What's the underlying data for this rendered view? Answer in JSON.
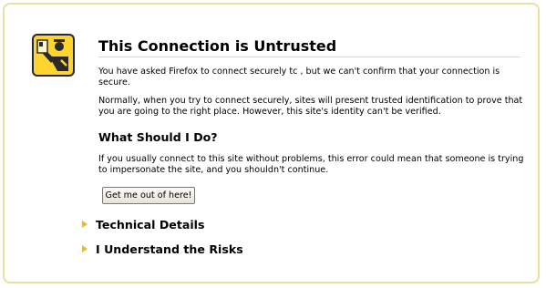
{
  "page": {
    "title": "This Connection is Untrusted",
    "intro": "You have asked Firefox to connect securely tc                   , but we can't confirm that your connection is secure.",
    "explanation": "Normally, when you try to connect securely, sites will present trusted identification to prove that you are going to the right place. However, this site's identity can't be verified.",
    "what_heading": "What Should I Do?",
    "advice": "If you usually connect to this site without problems, this error could mean that someone is trying to impersonate the site, and you shouldn't continue.",
    "escape_button": "Get me out of here!",
    "expanders": {
      "technical": "Technical Details",
      "risks": "I Understand the Risks"
    }
  },
  "icons": {
    "main": "security-warning-icon",
    "expander": "expand-triangle-icon"
  },
  "colors": {
    "frame_border": "#e9dfa3",
    "icon_bg": "#ffd52d",
    "icon_dark": "#2a2a2a",
    "triangle": "#e8b83a"
  }
}
